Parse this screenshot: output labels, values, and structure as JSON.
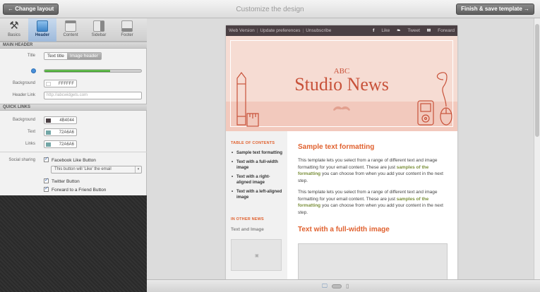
{
  "topbar": {
    "back_label": "← Change layout",
    "title": "Customize the design",
    "finish_label": "Finish & save template →"
  },
  "tabs": [
    {
      "label": "Basics",
      "icon": "wrench-icon"
    },
    {
      "label": "Header",
      "icon": "header-layout-icon",
      "active": true
    },
    {
      "label": "Content",
      "icon": "content-layout-icon"
    },
    {
      "label": "Sidebar",
      "icon": "sidebar-layout-icon"
    },
    {
      "label": "Footer",
      "icon": "footer-layout-icon"
    }
  ],
  "main_header": {
    "section_label": "MAIN HEADER",
    "title_label": "Title",
    "title_options": [
      "Text title",
      "Image header"
    ],
    "title_selected": "Image header",
    "size_fraction": 0.68,
    "background_label": "Background",
    "background_value": "FFFFFF",
    "header_link_label": "Header Link",
    "header_link_placeholder": "http://abcwidgets.com"
  },
  "quick_links": {
    "section_label": "QUICK LINKS",
    "background_label": "Background",
    "background_value": "4B4044",
    "background_color": "#4B4044",
    "text_label": "Text",
    "text_value": "72A6A6",
    "text_color": "#72A6A6",
    "links_label": "Links",
    "links_value": "72A6A6",
    "links_color": "#72A6A6"
  },
  "social": {
    "label": "Social sharing",
    "facebook_label": "Facebook Like Button",
    "facebook_select_value": "This button will 'Like' the email",
    "twitter_label": "Twitter Button",
    "forward_label": "Forward to a Friend Button"
  },
  "email": {
    "bar_left": [
      "Web Version",
      "Update preferences",
      "Unsubscribe"
    ],
    "bar_right": {
      "like": "Like",
      "tweet": "Tweet",
      "forward": "Forward"
    },
    "header_small": "ABC",
    "header_title": "Studio News",
    "sidebar": {
      "toc_heading": "TABLE OF CONTENTS",
      "toc_items": [
        "Sample text formatting",
        "Text with a full-width image",
        "Text with a right-aligned image",
        "Text with a left-aligned image"
      ],
      "news_heading": "IN OTHER NEWS",
      "news_title": "Text and Image"
    },
    "main": {
      "heading1": "Sample text formatting",
      "p1_before": "This template lets you select from a range of different text and image formatting for your email content. These are just ",
      "p1_link": "samples of the formatting",
      "p1_after": " you can choose from when you add your content in the next step.",
      "p2_before": "This template lets you select from a range of different text and image formatting for your email content. These are just ",
      "p2_link": "samples of the formatting",
      "p2_after": " you can choose from when you add your content in the next step.",
      "heading2": "Text with a full-width image"
    }
  }
}
